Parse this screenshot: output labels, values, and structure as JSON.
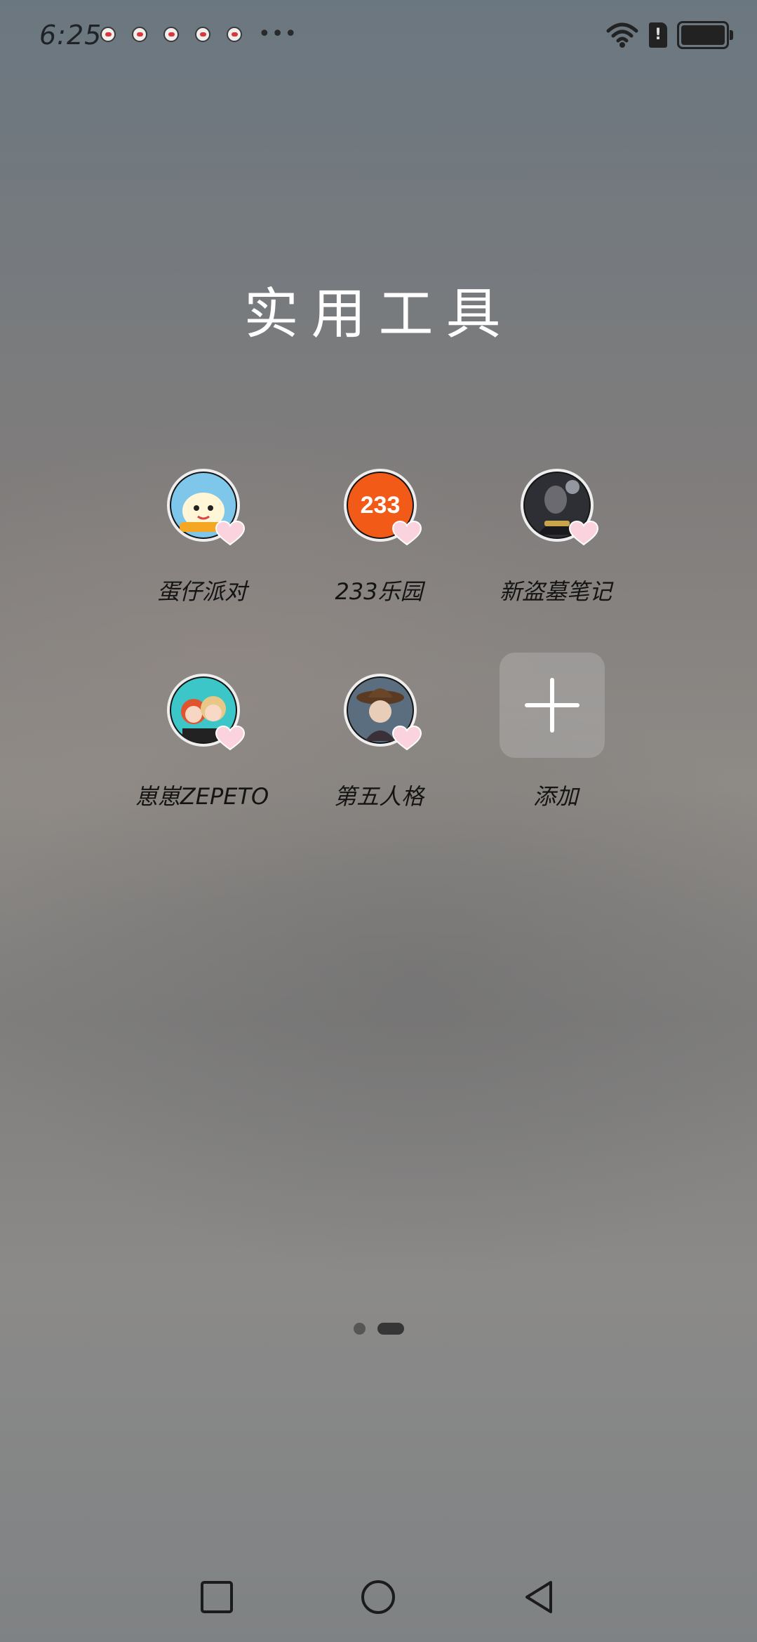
{
  "status_bar": {
    "time": "6:25",
    "notification_icons": [
      "app-notification-icon",
      "app-notification-icon",
      "app-notification-icon",
      "app-notification-icon",
      "app-notification-icon"
    ],
    "more": "•••",
    "sim_alert": "!",
    "battery_level": 1.0,
    "wifi": "wifi-icon"
  },
  "folder": {
    "title": "实用工具"
  },
  "apps": [
    {
      "label": "蛋仔派对",
      "icon": "eggy-party-icon",
      "color": "#7ec7ea"
    },
    {
      "label": "233乐园",
      "icon": "233-leyuan-icon",
      "color": "#f25a17",
      "icon_text": "233"
    },
    {
      "label": "新盗墓笔记",
      "icon": "tomb-notes-icon",
      "color": "#3b3b40"
    },
    {
      "label": "崽崽ZEPETO",
      "icon": "zepeto-icon",
      "color": "#3cc6c8"
    },
    {
      "label": "第五人格",
      "icon": "identity-v-icon",
      "color": "#5a6e80"
    }
  ],
  "add_button": {
    "label": "添加"
  },
  "pager": {
    "pages": 2,
    "current": 2
  },
  "nav": {
    "recents": "square-icon",
    "home": "circle-icon",
    "back": "triangle-back-icon"
  }
}
